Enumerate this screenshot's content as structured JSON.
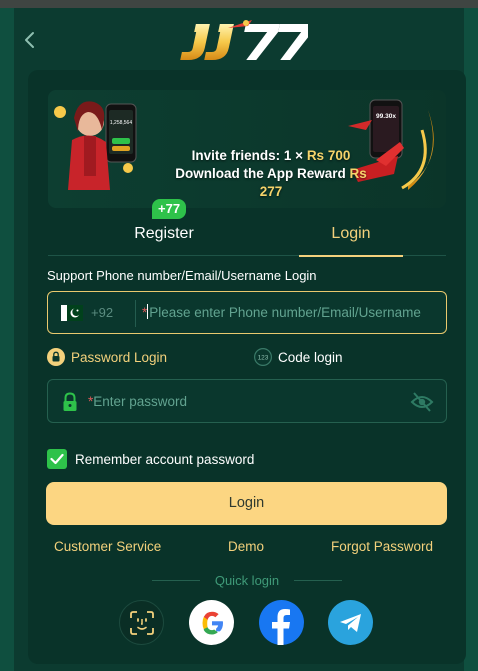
{
  "header": {
    "logo_text": "JJ77"
  },
  "banner": {
    "line1_prefix": "Invite friends: 1 × ",
    "line1_amount": "Rs 700",
    "line2_prefix": "Download the App Reward ",
    "line2_amount": "Rs 277",
    "phone_screen_text": "99.30x",
    "phone_small_text": "1,258,564"
  },
  "tabs": {
    "register_label": "Register",
    "register_badge": "+77",
    "login_label": "Login",
    "active": "Login"
  },
  "form": {
    "account_label": "Support Phone number/Email/Username Login",
    "country_code": "+92",
    "account_placeholder": "Please enter Phone number/Email/Username",
    "required_mark": "*",
    "password_mode_label": "Password Login",
    "code_mode_label": "Code login",
    "code_mode_icon_text": "123",
    "password_placeholder": "Enter password",
    "remember_label": "Remember account password",
    "remember_checked": true,
    "login_button": "Login"
  },
  "links": {
    "customer_service": "Customer Service",
    "demo": "Demo",
    "forgot_password": "Forgot Password"
  },
  "quick_login": {
    "label": "Quick login",
    "providers": [
      "face-id",
      "google",
      "facebook",
      "telegram"
    ]
  },
  "colors": {
    "background": "#0c3b30",
    "card": "#093329",
    "accent_gold": "#f3d17c",
    "button": "#fcd682",
    "badge_green": "#2ec24a",
    "muted_text": "#62a390"
  }
}
